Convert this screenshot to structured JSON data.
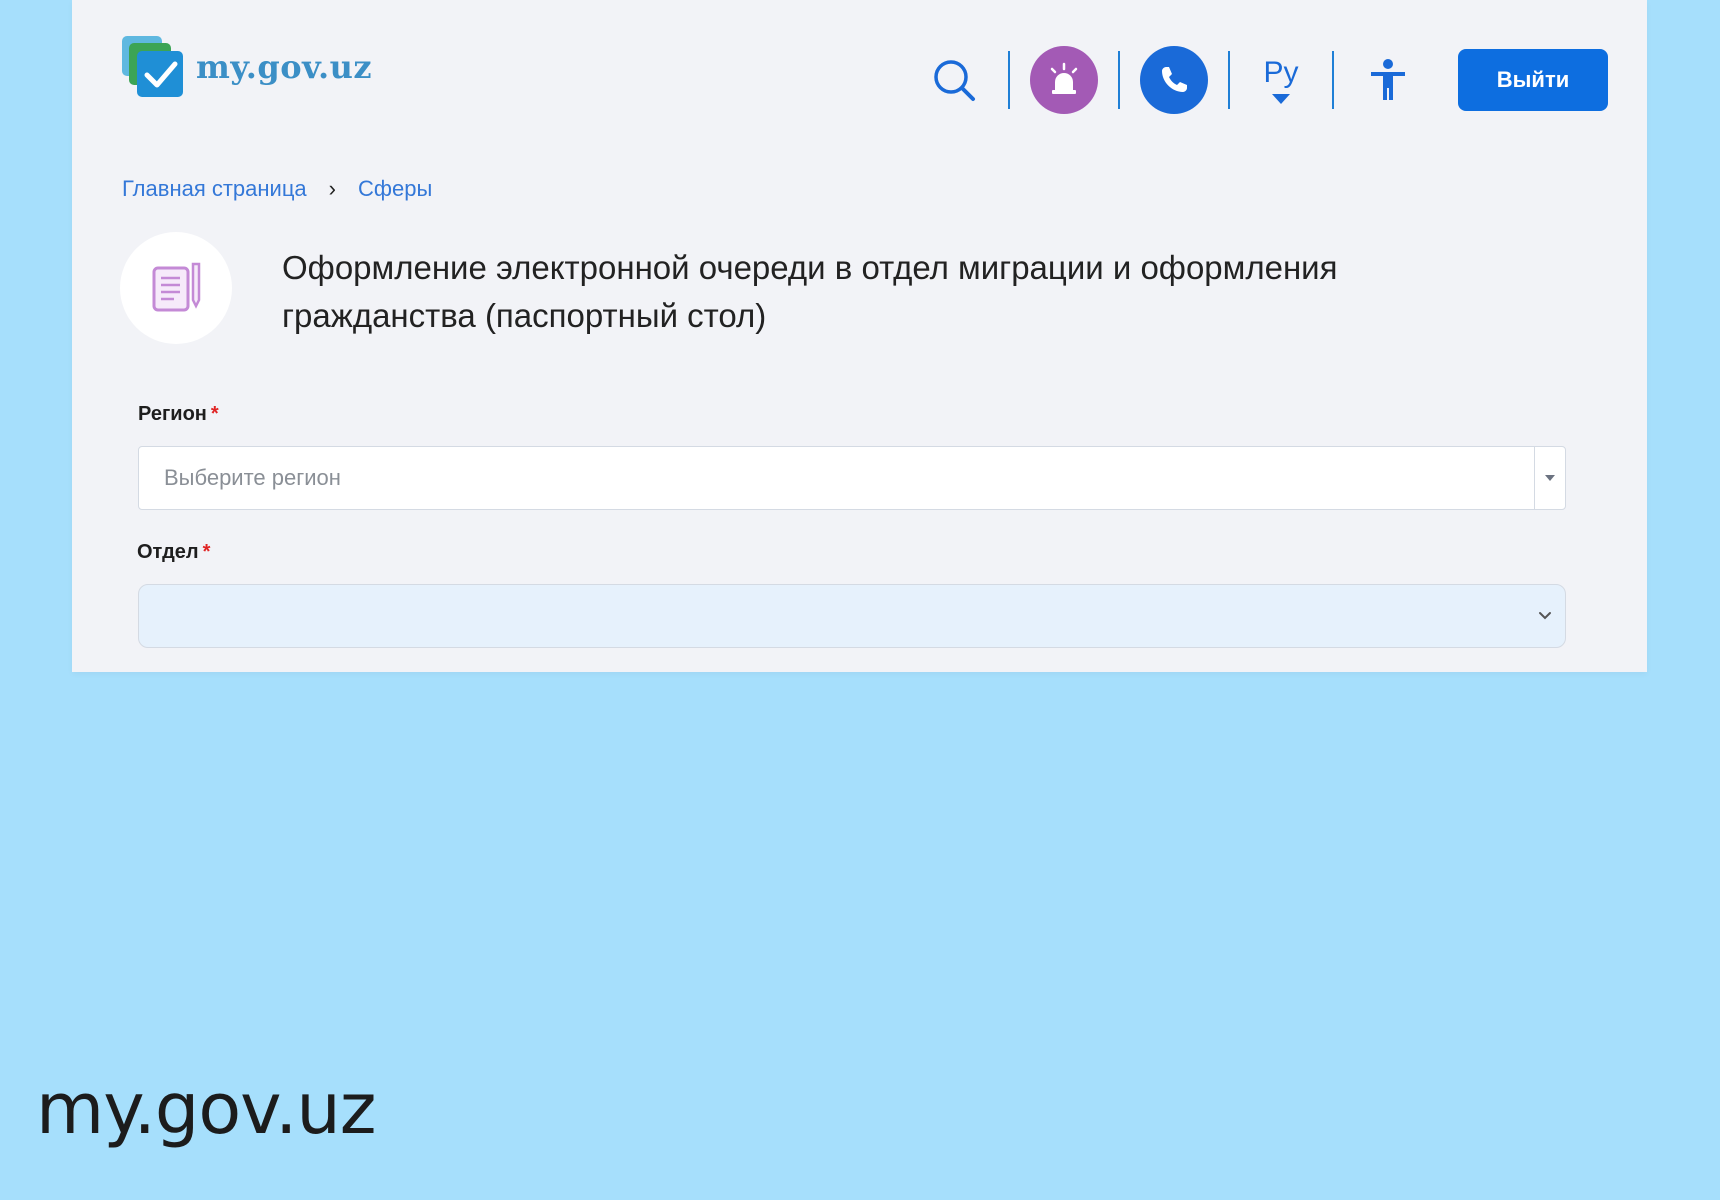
{
  "header": {
    "logo_text": "my.gov.uz",
    "language_label": "Ру",
    "logout_label": "Выйти"
  },
  "breadcrumb": {
    "items": [
      "Главная страница",
      "Сферы"
    ],
    "separator": "›"
  },
  "page": {
    "title": "Оформление электронной очереди в отдел миграции и оформления гражданства (паспортный стол)"
  },
  "form": {
    "region": {
      "label": "Регион",
      "required_mark": "*",
      "placeholder": "Выберите регион"
    },
    "department": {
      "label": "Отдел",
      "required_mark": "*",
      "value": ""
    }
  },
  "footer": {
    "brand_caption": "my.gov.uz"
  },
  "icons": {
    "search": "search-icon",
    "alarm": "alarm-siren-icon",
    "phone": "phone-icon",
    "accessibility": "accessibility-icon",
    "document": "document-pen-icon"
  },
  "colors": {
    "background": "#a6dffc",
    "card": "#f2f3f7",
    "primary": "#0d6ee0",
    "alarm": "#a35ab5",
    "link": "#3478d8",
    "required": "#e02424"
  }
}
